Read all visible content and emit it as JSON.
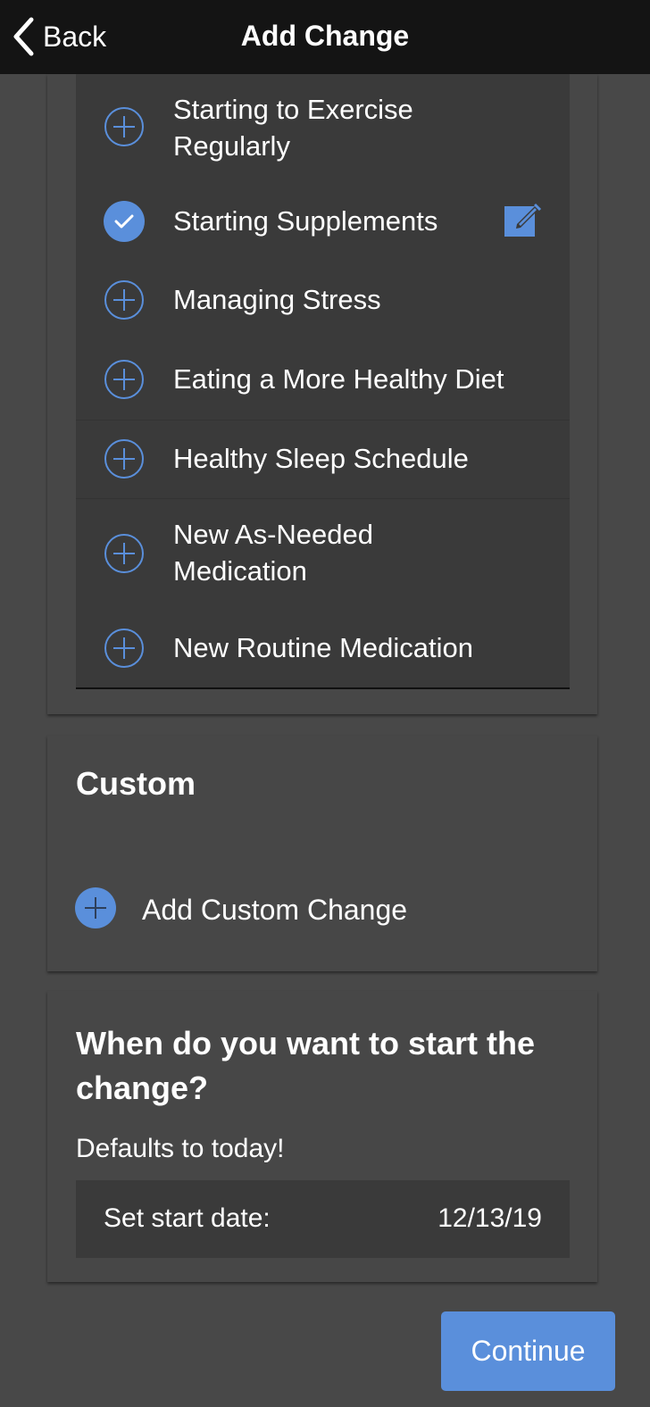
{
  "navbar": {
    "back_label": "Back",
    "title": "Add Change"
  },
  "changes": {
    "items": [
      {
        "label": "Starting to Exercise Regularly",
        "selected": false,
        "icon": "plus-circle-icon"
      },
      {
        "label": "Starting Supplements",
        "selected": true,
        "icon": "check-circle-icon",
        "edit_icon": "edit-icon"
      },
      {
        "label": "Managing Stress",
        "selected": false,
        "icon": "plus-circle-icon"
      },
      {
        "label": "Eating a More Healthy Diet",
        "selected": false,
        "icon": "plus-circle-icon"
      },
      {
        "label": "Healthy Sleep Schedule",
        "selected": false,
        "icon": "plus-circle-icon"
      },
      {
        "label": "New As-Needed Medication",
        "selected": false,
        "icon": "plus-circle-icon"
      },
      {
        "label": "New Routine Medication",
        "selected": false,
        "icon": "plus-circle-icon"
      }
    ]
  },
  "custom": {
    "title": "Custom",
    "add_label": "Add Custom Change"
  },
  "start_date": {
    "question": "When do you want to start the change?",
    "hint": "Defaults to today!",
    "field_label": "Set start date:",
    "value": "12/13/19"
  },
  "continue_label": "Continue",
  "colors": {
    "accent": "#5a8fdb",
    "navbar": "#141414",
    "background": "#484848",
    "card": "#474747",
    "list": "#3a3a3a"
  }
}
